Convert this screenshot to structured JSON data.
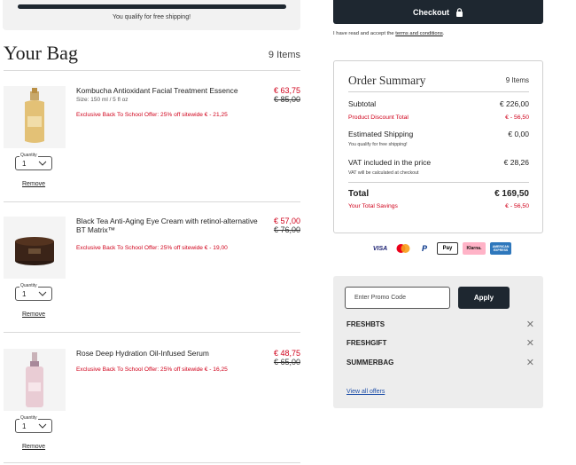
{
  "shipping": {
    "message": "You qualify for free shipping!",
    "progress_percent": 100
  },
  "bag": {
    "title": "Your Bag",
    "count": "9 Items",
    "quantity_label": "Quantity",
    "remove_label": "Remove",
    "items": [
      {
        "name": "Kombucha Antioxidant Facial Treatment Essence",
        "size": "Size: 150 ml / 5 fl oz",
        "offer": "Exclusive Back To School Offer: 25% off sitewide € - 21,25",
        "price_new": "€ 63,75",
        "price_old": "€ 85,00",
        "quantity": "1"
      },
      {
        "name": "Black Tea Anti-Aging Eye Cream with retinol-alternative BT Matrix™",
        "size": "",
        "offer": "Exclusive Back To School Offer: 25% off sitewide € - 19,00",
        "price_new": "€ 57,00",
        "price_old": "€ 76,00",
        "quantity": "1"
      },
      {
        "name": "Rose Deep Hydration Oil-Infused Serum",
        "size": "",
        "offer": "Exclusive Back To School Offer: 25% off sitewide € - 16,25",
        "price_new": "€ 48,75",
        "price_old": "€ 65,00",
        "quantity": "1"
      }
    ]
  },
  "checkout": {
    "button_label": "Checkout",
    "terms_prefix": "I have read and accept the ",
    "terms_link": "terms and conditions",
    "terms_suffix": "."
  },
  "summary": {
    "title": "Order Summary",
    "count": "9 Items",
    "subtotal_label": "Subtotal",
    "subtotal": "€ 226,00",
    "discount_label": "Product Discount Total",
    "discount": "€ - 56,50",
    "shipping_label": "Estimated Shipping",
    "shipping": "€ 0,00",
    "shipping_note": "You qualify for free shipping!",
    "vat_label": "VAT included in the price",
    "vat": "€ 28,26",
    "vat_note": "VAT will be calculated at checkout",
    "total_label": "Total",
    "total": "€ 169,50",
    "savings_label": "Your Total Savings",
    "savings": "€ - 56,50"
  },
  "payments": {
    "visa": "VISA",
    "mastercard": "mastercard",
    "paypal": "P",
    "applepay": "Pay",
    "klarna": "Klarna.",
    "amex": "AMERICAN EXPRESS"
  },
  "promo": {
    "placeholder": "Enter Promo Code",
    "apply_label": "Apply",
    "codes": [
      "FRESHBTS",
      "FRESHGIFT",
      "SUMMERBAG"
    ],
    "view_all": "View all offers"
  },
  "colors": {
    "dark": "#1e2730",
    "sale_red": "#d0021b",
    "promo_bg": "#ededed"
  }
}
